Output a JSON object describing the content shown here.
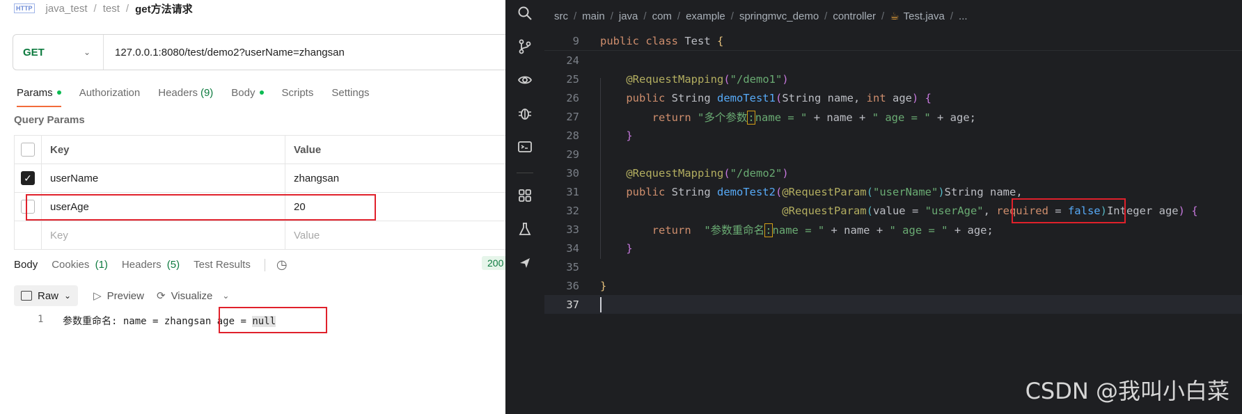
{
  "breadcrumb": {
    "badge": "HTTP",
    "items": [
      "java_test",
      "test"
    ],
    "current": "get方法请求"
  },
  "request": {
    "method": "GET",
    "url": "127.0.0.1:8080/test/demo2?userName=zhangsan"
  },
  "request_tabs": [
    {
      "label": "Params",
      "dot": true
    },
    {
      "label": "Authorization"
    },
    {
      "label": "Headers",
      "count": "(9)"
    },
    {
      "label": "Body",
      "dot": true
    },
    {
      "label": "Scripts"
    },
    {
      "label": "Settings"
    }
  ],
  "query_params": {
    "title": "Query Params",
    "headers": {
      "key": "Key",
      "value": "Value"
    },
    "rows": [
      {
        "checked": true,
        "key": "userName",
        "value": "zhangsan"
      },
      {
        "checked": false,
        "key": "userAge",
        "value": "20"
      }
    ],
    "placeholder": {
      "key": "Key",
      "value": "Value"
    }
  },
  "response_tabs": {
    "body": "Body",
    "cookies": "Cookies",
    "cookies_count": "(1)",
    "headers": "Headers",
    "headers_count": "(5)",
    "tests": "Test Results"
  },
  "status": "200",
  "response_toolbar": {
    "raw": "Raw",
    "preview": "Preview",
    "visualize": "Visualize"
  },
  "response_body": {
    "line_no": "1",
    "text": "参数重命名: name = zhangsan",
    "tail": " age = ",
    "null_val": "null"
  },
  "editor": {
    "breadcrumb": [
      "src",
      "main",
      "java",
      "com",
      "example",
      "springmvc_demo",
      "controller"
    ],
    "file": "Test.java",
    "ellipsis": "...",
    "line_numbers": [
      "9",
      "24",
      "25",
      "26",
      "27",
      "28",
      "29",
      "30",
      "31",
      "32",
      "33",
      "34",
      "35",
      "36",
      "37"
    ]
  },
  "watermark": "CSDN @我叫小白菜",
  "icons": [
    "search-icon",
    "git-branch-icon",
    "eye-icon",
    "debug-icon",
    "terminal-icon",
    "extensions-icon",
    "flask-icon",
    "send-icon",
    "history-icon",
    "chevron-down-icon",
    "preview-icon",
    "visualize-icon",
    "java-file-icon"
  ]
}
